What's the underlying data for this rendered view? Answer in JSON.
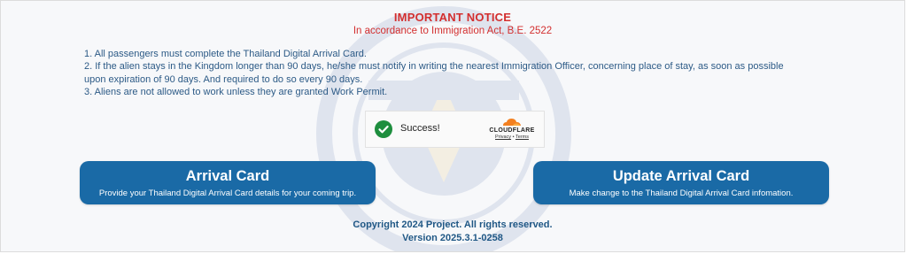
{
  "notice": {
    "title": "IMPORTANT NOTICE",
    "subtitle": "In accordance to Immigration Act, B.E. 2522"
  },
  "rules": [
    "1. All passengers must complete the Thailand Digital Arrival Card.",
    "2. If the alien stays in the Kingdom longer than 90 days, he/she must notify in writing the nearest Immigration Officer, concerning place of stay, as soon as possible upon expiration of 90 days. And required to do so every 90 days.",
    "3. Aliens are not allowed to work unless they are granted Work Permit."
  ],
  "captcha": {
    "status_text": "Success!",
    "brand": "CLOUDFLARE",
    "privacy_label": "Privacy",
    "separator": "•",
    "terms_label": "Terms",
    "check_icon": "check-circle-icon"
  },
  "buttons": {
    "arrival": {
      "title": "Arrival Card",
      "description": "Provide your Thailand Digital Arrival Card details for your coming trip."
    },
    "update": {
      "title": "Update Arrival Card",
      "description": "Make change to the Thailand Digital Arrival Card infomation."
    }
  },
  "footer": {
    "copyright": "Copyright 2024 Project. All rights reserved.",
    "version": "Version 2025.3.1-0258"
  },
  "colors": {
    "notice_red": "#d32f2f",
    "text_blue": "#2c5a86",
    "button_blue": "#1a6aa6",
    "success_green": "#1e8e3e",
    "cloudflare_orange": "#f38020"
  }
}
